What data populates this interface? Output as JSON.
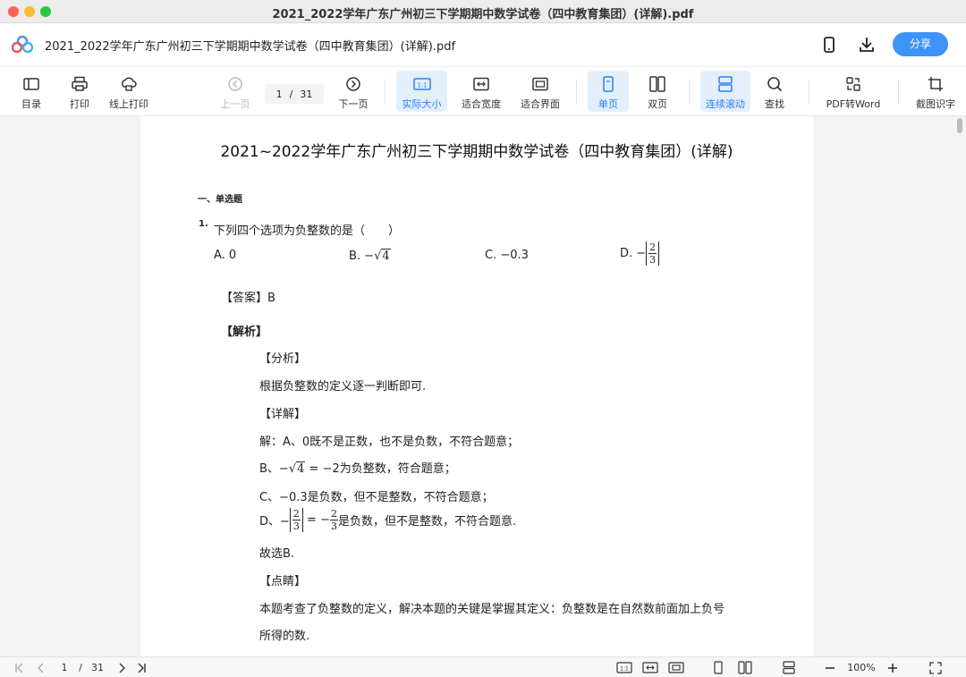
{
  "window": {
    "title": "2021_2022学年广东广州初三下学期期中数学试卷（四中教育集团）(详解).pdf"
  },
  "header": {
    "doc_title": "2021_2022学年广东广州初三下学期期中数学试卷（四中教育集团）(详解).pdf",
    "share_label": "分享",
    "accent_color": "#3e93f7"
  },
  "toolbar": {
    "toc": "目录",
    "print": "打印",
    "online_print": "线上打印",
    "prev_page": "上一页",
    "current_page": "1",
    "page_sep": "/",
    "total_pages": "31",
    "next_page": "下一页",
    "actual_size": "实际大小",
    "fit_width": "适合宽度",
    "fit_page": "适合界面",
    "single_page": "单页",
    "double_page": "双页",
    "continuous": "连续滚动",
    "find": "查找",
    "pdf_to_word": "PDF转Word",
    "ocr": "截图识字",
    "actual_size_icon_text": "1:1"
  },
  "document": {
    "title": "2021~2022学年广东广州初三下学期期中数学试卷（四中教育集团）(详解)",
    "section": "一、单选题",
    "q_num": "1.",
    "question": "下列四个选项为负整数的是（　　）",
    "opt_a": "A. 0",
    "opt_b_prefix": "B. −",
    "opt_b_rad": "4",
    "opt_c": "C. −0.3",
    "opt_d_prefix": "D. −",
    "frac_num": "2",
    "frac_den": "3",
    "answer_label": "【答案】",
    "answer_value": "B",
    "analysis_label": "【解析】",
    "fenxi_label": "【分析】",
    "fenxi_text": "根据负整数的定义逐一判断即可.",
    "xiangjie_label": "【详解】",
    "line_a": "解：A、0既不是正数，也不是负数，不符合题意；",
    "line_b_prefix": "B、−",
    "line_b_rad": "4",
    "line_b_mid": " = −2",
    "line_b_suffix": "为负整数，符合题意；",
    "line_c_prefix": "C、",
    "line_c_math": "−0.3",
    "line_c_suffix": "是负数，但不是整数，不符合题意；",
    "line_d_prefix": "D、−",
    "line_d_mid": " = −",
    "line_d_suffix": "是负数，但不是整数，不符合题意.",
    "choose": "故选B.",
    "dianjing_label": "【点睛】",
    "dianjing_text1": "本题考查了负整数的定义，解决本题的关键是掌握其定义：负整数是在自然数前面加上负号",
    "dianjing_text2": "所得的数."
  },
  "statusbar": {
    "current_page": "1",
    "page_sep": "/",
    "total_pages": "31",
    "zoom": "100%",
    "actual_size_icon_text": "1:1"
  }
}
